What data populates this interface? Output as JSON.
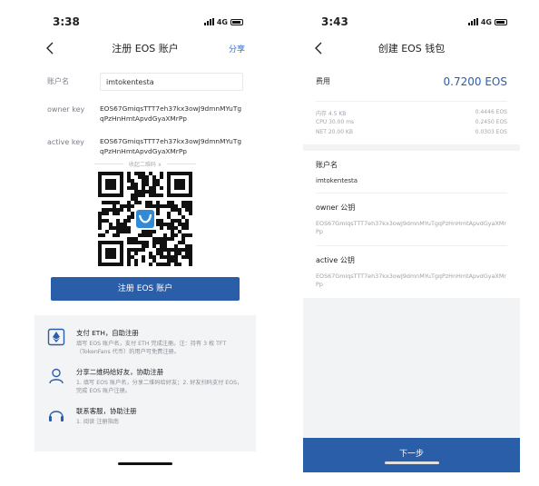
{
  "register_screen": {
    "status": {
      "time": "3:38",
      "network": "4G"
    },
    "nav": {
      "title": "注册 EOS 账户",
      "share": "分享"
    },
    "account_label": "账户名",
    "account_value": "imtokentesta",
    "owner_label": "owner key",
    "owner_key": "EOS67GmiqsTTT7eh37kx3owJ9dmnMYuTgqPzHnHmtApvdGyaXMrPp",
    "active_label": "active key",
    "active_key": "EOS67GmiqsTTT7eh37kx3owJ9dmnMYuTgqPzHnHmtApvdGyaXMrPp",
    "collapse_qr": "收起二维码 ∧",
    "register_button": "注册 EOS 账户",
    "guides": [
      {
        "icon": "eth-icon",
        "title": "支付 ETH，自助注册",
        "desc": "填写 EOS 账户名，支付 ETH 完成注册。注：持有 3 枚 TFT（TokenFans 代币）的用户可免费注册。"
      },
      {
        "icon": "person-icon",
        "title": "分享二维码给好友，协助注册",
        "desc": "1. 填写 EOS 账户名，分享二维码给好友；2. 好友扫码支付 EOS，完成 EOS 账户注册。"
      },
      {
        "icon": "headset-icon",
        "title": "联系客服，协助注册",
        "desc": "1. 阅读 注册指南"
      }
    ]
  },
  "wallet_screen": {
    "status": {
      "time": "3:43",
      "network": "4G"
    },
    "nav": {
      "title": "创建 EOS 钱包"
    },
    "fee_label": "费用",
    "fee_value": "0.7200 EOS",
    "resources": [
      {
        "label": "内存 4.5 KB",
        "value": "0.4446 EOS"
      },
      {
        "label": "CPU 30.00 ms",
        "value": "0.2450 EOS"
      },
      {
        "label": "NET 20.00 KB",
        "value": "0.0303 EOS"
      }
    ],
    "account_label": "账户名",
    "account_value": "imtokentesta",
    "owner_label": "owner 公钥",
    "owner_key": "EOS67GmiqsTTT7eh37kx3owJ9dmnMYuTgqPzHnHmtApvdGyaXMrPp",
    "active_label": "active 公钥",
    "active_key": "EOS67GmiqsTTT7eh37kx3owJ9dmnMYuTgqPzHnHmtApvdGyaXMrPp",
    "next_button": "下一步"
  },
  "colors": {
    "accent": "#2b5ea8",
    "link": "#2d6fd6"
  }
}
